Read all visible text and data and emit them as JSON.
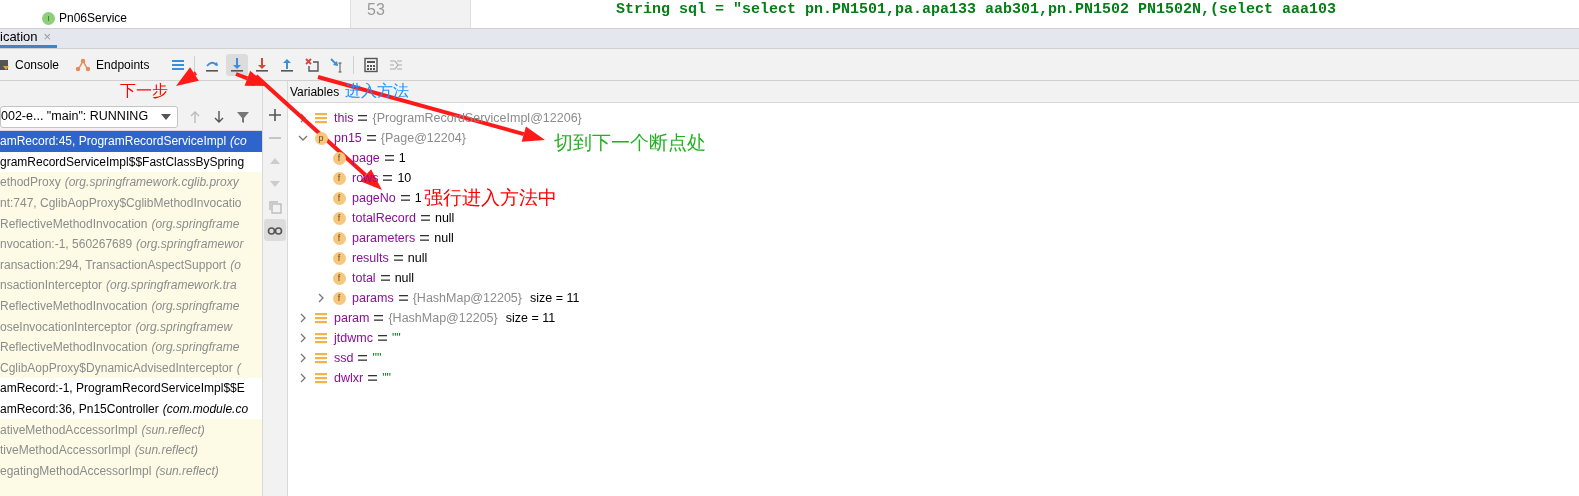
{
  "project_tree": {
    "items": [
      {
        "label": "Pn06Service",
        "icon": "I"
      }
    ]
  },
  "editor": {
    "line_number": "53",
    "code": "String sql = \"select pn.PN1501,pa.apa133 aab301,pn.PN1502 PN1502N,(select aaa103"
  },
  "tool_window": {
    "tab": {
      "label": "ication",
      "selected": true
    },
    "close": "×"
  },
  "toolbar": {
    "tabs": [
      {
        "label": "Console",
        "kind": "console"
      },
      {
        "label": "Endpoints",
        "kind": "endpoints"
      }
    ],
    "buttons": [
      {
        "kind": "layout",
        "selected": false
      },
      {
        "kind": "step-over",
        "selected": false
      },
      {
        "kind": "step-into",
        "selected": true
      },
      {
        "kind": "force-step-into",
        "selected": false
      },
      {
        "kind": "step-out",
        "selected": false
      },
      {
        "kind": "drop-frame",
        "selected": false
      },
      {
        "kind": "run-to-cursor",
        "selected": false
      },
      {
        "kind": "evaluate",
        "selected": false
      },
      {
        "kind": "trace",
        "selected": false
      }
    ]
  },
  "frames": {
    "thread": "002-e... \"main\": RUNNING",
    "rows": [
      {
        "method": "amRecord:45, ProgramRecordServiceImpl",
        "location": "(co",
        "kind": "app",
        "selected": true
      },
      {
        "method": "gramRecordServiceImpl$$FastClassBySpring",
        "kind": "app",
        "selected": false
      },
      {
        "method": "ethodProxy",
        "location": "(org.springframework.cglib.proxy",
        "kind": "library",
        "selected": false
      },
      {
        "method": "nt:747, CglibAopProxy$CglibMethodInvocatio",
        "kind": "library",
        "selected": false
      },
      {
        "method": "ReflectiveMethodInvocation",
        "location": "(org.springframe",
        "kind": "library",
        "selected": false
      },
      {
        "method": "nvocation:-1, 560267689",
        "location": "(org.springframewor",
        "kind": "library",
        "selected": false
      },
      {
        "method": "ransaction:294, TransactionAspectSupport",
        "location": "(o",
        "kind": "library",
        "selected": false
      },
      {
        "method": "nsactionInterceptor",
        "location": "(org.springframework.tra",
        "kind": "library",
        "selected": false
      },
      {
        "method": "ReflectiveMethodInvocation",
        "location": "(org.springframe",
        "kind": "library",
        "selected": false
      },
      {
        "method": "oseInvocationInterceptor",
        "location": "(org.springframew",
        "kind": "library",
        "selected": false
      },
      {
        "method": "ReflectiveMethodInvocation",
        "location": "(org.springframe",
        "kind": "library",
        "selected": false
      },
      {
        "method": "CglibAopProxy$DynamicAdvisedInterceptor",
        "location": "(",
        "kind": "library",
        "selected": false
      },
      {
        "method": "amRecord:-1, ProgramRecordServiceImpl$$E",
        "kind": "app",
        "selected": false
      },
      {
        "method": "amRecord:36, Pn15Controller",
        "location": "(com.module.co",
        "kind": "app",
        "selected": false
      },
      {
        "method": "ativeMethodAccessorImpl",
        "location": "(sun.reflect)",
        "kind": "library",
        "selected": false
      },
      {
        "method": "tiveMethodAccessorImpl",
        "location": "(sun.reflect)",
        "kind": "library",
        "selected": false
      },
      {
        "method": "egatingMethodAccessorImpl",
        "location": "(sun.reflect)",
        "kind": "library",
        "selected": false
      }
    ]
  },
  "side_buttons": [
    {
      "kind": "add",
      "selected": false
    },
    {
      "kind": "remove",
      "selected": false
    },
    {
      "kind": "up",
      "selected": false
    },
    {
      "kind": "down",
      "selected": false
    },
    {
      "kind": "copy",
      "selected": false
    },
    {
      "kind": "watches",
      "selected": true
    }
  ],
  "variables": {
    "title": "Variables",
    "items": [
      {
        "name": "this",
        "value": "{ProgramRecordServiceImpl@12206}",
        "kind": "ref",
        "expanded": false
      },
      {
        "name": "pn15",
        "icon": "p",
        "value": "{Page@12204}",
        "kind": "ref",
        "expanded": true,
        "children": [
          {
            "name": "page",
            "icon": "f",
            "value": "1",
            "kind": "prim"
          },
          {
            "name": "rows",
            "icon": "f",
            "value": "10",
            "kind": "prim"
          },
          {
            "name": "pageNo",
            "icon": "f",
            "value": "1",
            "kind": "prim"
          },
          {
            "name": "totalRecord",
            "icon": "f",
            "value": "null",
            "kind": "prim"
          },
          {
            "name": "parameters",
            "icon": "f",
            "value": "null",
            "kind": "prim"
          },
          {
            "name": "results",
            "icon": "f",
            "value": "null",
            "kind": "prim"
          },
          {
            "name": "total",
            "icon": "f",
            "value": "null",
            "kind": "prim"
          },
          {
            "name": "params",
            "icon": "f",
            "value": "{HashMap@12205}",
            "size": "size = 11",
            "kind": "ref",
            "expanded": false
          }
        ]
      },
      {
        "name": "param",
        "value": "{HashMap@12205}",
        "size": "size = 11",
        "kind": "ref",
        "expanded": false
      },
      {
        "name": "jtdwmc",
        "value": "\"\"",
        "kind": "str",
        "expanded": false
      },
      {
        "name": "ssd",
        "value": "\"\"",
        "kind": "str",
        "expanded": false
      },
      {
        "name": "dwlxr",
        "value": "\"\"",
        "kind": "str",
        "expanded": false
      }
    ]
  },
  "annotations": [
    {
      "text": "下一步",
      "color": "#ff0000"
    },
    {
      "text": "进入方法",
      "color": "#1e90ff"
    },
    {
      "text": "强行进入方法中",
      "color": "#ff0000"
    },
    {
      "text": "切到下一个断点处",
      "color": "#22b022"
    }
  ]
}
